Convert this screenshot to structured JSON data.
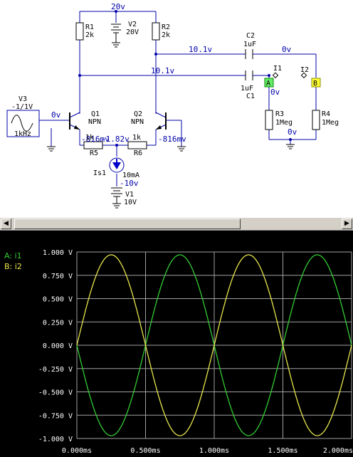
{
  "schematic": {
    "node_supply": "20v",
    "node_c2_right": "0v",
    "node_collector_q2": "10.1v",
    "node_collector_q1": "10.1v",
    "node_input": "0v",
    "node_out_i1": "0v",
    "node_bottom_out": "0v",
    "node_emitter_q1": "-816mv",
    "node_tail": "-1.82v",
    "node_emitter_q2": "-816mv",
    "node_v1": "-10v",
    "r1": {
      "name": "R1",
      "value": "2k"
    },
    "r2": {
      "name": "R2",
      "value": "2k"
    },
    "v2": {
      "name": "V2",
      "value": "20V"
    },
    "c2": {
      "name": "C2",
      "value": "1uF"
    },
    "c1": {
      "name": "C1",
      "value": "1uF"
    },
    "i1": "I1",
    "i2": "I2",
    "probe_a": "A",
    "probe_b": "B",
    "r3": {
      "name": "R3",
      "value": "1Meg"
    },
    "r4": {
      "name": "R4",
      "value": "1Meg"
    },
    "v3": {
      "name": "V3",
      "value": "-1/1V",
      "freq": "1kHz"
    },
    "q1": {
      "name": "Q1",
      "type": "NPN"
    },
    "q2": {
      "name": "Q2",
      "type": "NPN"
    },
    "r5": {
      "name": "R5",
      "value": "1k"
    },
    "r6": {
      "name": "R6",
      "value": "1k"
    },
    "is1": {
      "name": "Is1",
      "value": "10mA"
    },
    "v1": {
      "name": "V1",
      "value": "10V"
    }
  },
  "scope": {
    "legend_a": "A: i1",
    "legend_b": "B: i2",
    "colors": {
      "a": "#33cc33",
      "b": "#e6e64d",
      "grid": "#a0a0a0",
      "background": "#000000"
    }
  },
  "chart_data": {
    "type": "line",
    "x_unit": "ms",
    "xlim": [
      0,
      2.0
    ],
    "ylim": [
      -1.0,
      1.0
    ],
    "x_ticks": [
      "0.000ms",
      "0.500ms",
      "1.000ms",
      "1.500ms",
      "2.000ms"
    ],
    "y_ticks": [
      "1.000 V",
      "0.750 V",
      "0.500 V",
      "0.250 V",
      "0.000 V",
      "-0.250 V",
      "-0.500 V",
      "-0.750 V",
      "-1.000 V"
    ],
    "grid": true,
    "series": [
      {
        "name": "A: i1",
        "color": "#33cc33",
        "amplitude": 0.97,
        "frequency_khz": 1.0,
        "phase_deg": 180
      },
      {
        "name": "B: i2",
        "color": "#e6e64d",
        "amplitude": 0.97,
        "frequency_khz": 1.0,
        "phase_deg": 0
      }
    ]
  }
}
